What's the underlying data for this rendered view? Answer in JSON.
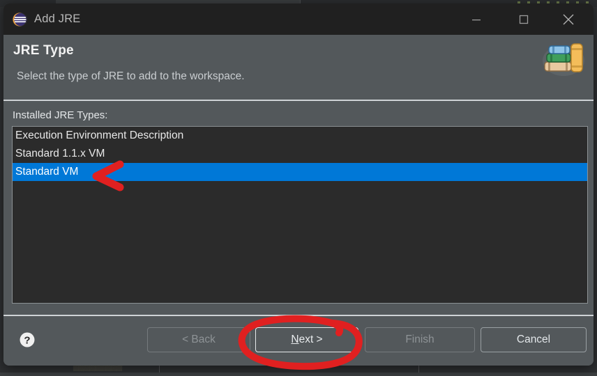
{
  "window": {
    "title": "Add JRE",
    "icon": "eclipse-icon",
    "controls": {
      "minimize": "—",
      "maximize": "☐",
      "close": "✕"
    }
  },
  "header": {
    "title": "JRE Type",
    "description": "Select the type of JRE to add to the workspace.",
    "illustration": "books-stack-icon"
  },
  "content": {
    "list_label": "Installed JRE Types:",
    "items": [
      {
        "label": "Execution Environment Description",
        "selected": false
      },
      {
        "label": "Standard 1.1.x VM",
        "selected": false
      },
      {
        "label": "Standard VM",
        "selected": true
      }
    ]
  },
  "buttons": {
    "help": "?",
    "back": "< Back",
    "next_mnemonic": "N",
    "next_rest": "ext >",
    "finish": "Finish",
    "cancel": "Cancel"
  },
  "annotations": {
    "arrow_color": "#e02020",
    "ellipse_color": "#e02020",
    "arrow_target": "Standard VM",
    "ellipse_target": "Next >"
  },
  "backdrop": {
    "bottom_tab_label": "▒▒▒▒▒▒▒▒▒"
  },
  "colors": {
    "accent_selection": "#0078d7",
    "dialog_background": "#53585b",
    "titlebar_background": "#202020",
    "list_background": "#2b2b2b",
    "annotation_red": "#e02020"
  }
}
